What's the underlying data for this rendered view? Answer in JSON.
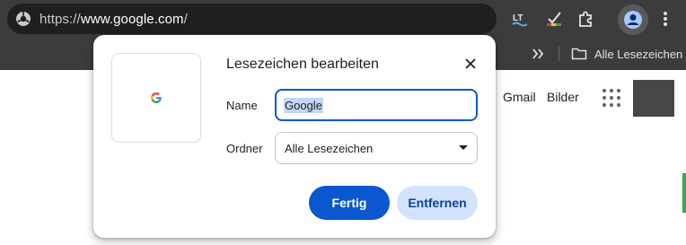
{
  "browser": {
    "url_scheme": "https://",
    "url_host": "www.google.com",
    "url_path": "/",
    "bookmarks_bar": {
      "all_bookmarks_label": "Alle Lesezeichen"
    }
  },
  "page": {
    "gmail_link": "Gmail",
    "images_link": "Bilder"
  },
  "dialog": {
    "title": "Lesezeichen bearbeiten",
    "name_label": "Name",
    "name_value": "Google",
    "folder_label": "Ordner",
    "folder_value": "Alle Lesezeichen",
    "done_button": "Fertig",
    "remove_button": "Entfernen"
  },
  "colors": {
    "toolbar_bg": "#3c3c3c",
    "omnibox_bg": "#1f1f1f",
    "primary_blue": "#0b57d0",
    "secondary_button_bg": "#d3e3fd"
  },
  "icons": {
    "site_info": "tune-icon",
    "languagetool": "languagetool-extension-icon",
    "grammar": "grammar-checker-extension-icon",
    "extensions": "puzzle-icon",
    "profile": "profile-icon",
    "menu": "kebab-menu-icon",
    "overflow": "double-chevron-icon",
    "folder": "folder-icon",
    "favicon": "google-g-icon",
    "close": "close-icon",
    "dropdown": "caret-down-icon",
    "apps": "apps-grid-icon"
  }
}
